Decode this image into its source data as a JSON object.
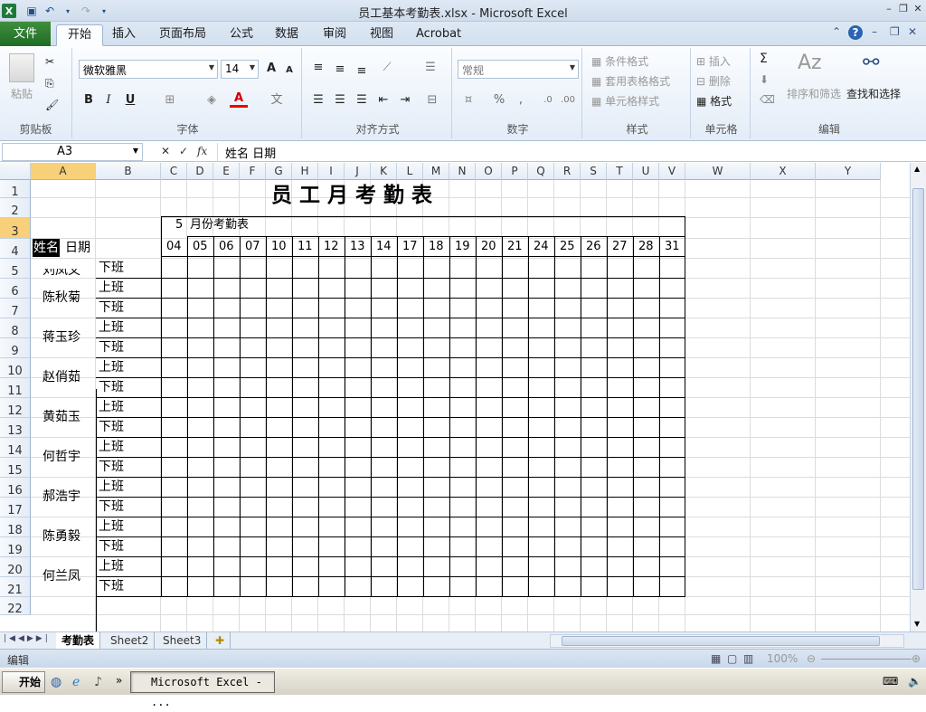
{
  "window": {
    "title": "员工基本考勤表.xlsx - Microsoft Excel",
    "app_badge": "X"
  },
  "ribbon": {
    "tabs": [
      "文件",
      "开始",
      "插入",
      "页面布局",
      "公式",
      "数据",
      "审阅",
      "视图",
      "Acrobat"
    ],
    "active_tab": "开始",
    "clipboard": {
      "paste": "粘贴",
      "label": "剪贴板"
    },
    "font": {
      "name": "微软雅黑",
      "size": "14",
      "bold": "B",
      "italic": "I",
      "underline": "U",
      "grow": "A",
      "shrink": "A",
      "label": "字体"
    },
    "alignment": {
      "label": "对齐方式"
    },
    "number": {
      "format": "常规",
      "percent": "%",
      "comma": ",",
      "label": "数字"
    },
    "styles": {
      "conditional": "条件格式",
      "table": "套用表格格式",
      "cell": "单元格样式",
      "label": "样式"
    },
    "cells": {
      "insert": "插入",
      "delete": "删除",
      "format": "格式",
      "label": "单元格"
    },
    "editing": {
      "sum": "Σ",
      "sort": "排序和筛选",
      "find": "查找和选择",
      "label": "编辑"
    }
  },
  "formula_bar": {
    "name_box": "A3",
    "content": "姓名    日期",
    "fx": "fx"
  },
  "sheet": {
    "columns": [
      "A",
      "B",
      "C",
      "D",
      "E",
      "F",
      "G",
      "H",
      "I",
      "J",
      "K",
      "L",
      "M",
      "N",
      "O",
      "P",
      "Q",
      "R",
      "S",
      "T",
      "U",
      "V",
      "W",
      "X",
      "Y"
    ],
    "rows": [
      "1",
      "2",
      "3",
      "4",
      "5",
      "6",
      "7",
      "8",
      "9",
      "10",
      "11",
      "12",
      "13",
      "14",
      "15",
      "16",
      "17",
      "18",
      "19",
      "20",
      "21",
      "22"
    ],
    "selected_col": "A",
    "selected_row": "3",
    "title": "员工月考勤表",
    "month_number": "5",
    "month_label": "月份考勤表",
    "name_header": "姓名",
    "date_header": "日期",
    "dates": [
      "04",
      "05",
      "06",
      "07",
      "10",
      "11",
      "12",
      "13",
      "14",
      "17",
      "18",
      "19",
      "20",
      "21",
      "24",
      "25",
      "26",
      "27",
      "28",
      "31"
    ],
    "first_employee_partial": "刘凤文",
    "employees": [
      "陈秋菊",
      "蒋玉珍",
      "赵俏茹",
      "黄茹玉",
      "何哲宇",
      "郝浩宇",
      "陈勇毅",
      "何兰凤"
    ],
    "shift_on": "上班",
    "shift_off": "下班"
  },
  "sheet_tabs": [
    "考勤表",
    "Sheet2",
    "Sheet3"
  ],
  "status": {
    "mode": "编辑",
    "zoom": "100%"
  },
  "taskbar": {
    "start": "开始",
    "window": "Microsoft Excel - ..."
  }
}
